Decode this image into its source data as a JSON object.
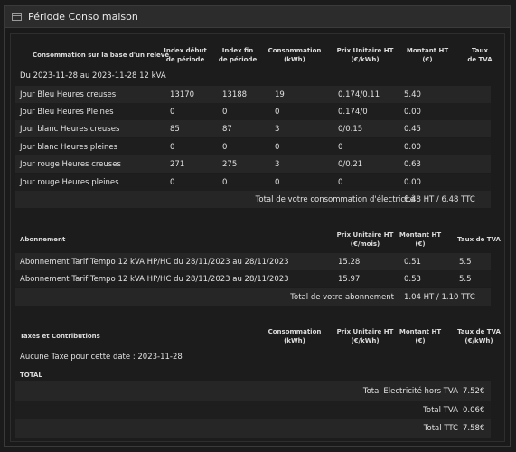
{
  "panel": {
    "title": "Période Conso maison"
  },
  "consumption": {
    "headers": {
      "label": "Consommation sur la base d'un relevé",
      "index_start": [
        "Index début",
        "de période"
      ],
      "index_end": [
        "Index fin",
        "de période"
      ],
      "conso": [
        "Consommation",
        "(kWh)"
      ],
      "unit_price": [
        "Prix Unitaire HT",
        "(€/kWh)"
      ],
      "amount": [
        "Montant HT",
        "(€)"
      ],
      "vat": [
        "Taux",
        "de TVA"
      ]
    },
    "period": "Du 2023-11-28 au 2023-11-28 12 kVA",
    "rows": [
      {
        "label": "Jour Bleu Heures creuses",
        "start": "13170",
        "end": "13188",
        "kwh": "19",
        "price": "0.174/0.11",
        "amount": "5.40",
        "vat": ""
      },
      {
        "label": "Jour Bleu Heures Pleines",
        "start": "0",
        "end": "0",
        "kwh": "0",
        "price": "0.174/0",
        "amount": "0.00",
        "vat": ""
      },
      {
        "label": "Jour blanc Heures creuses",
        "start": "85",
        "end": "87",
        "kwh": "3",
        "price": "0/0.15",
        "amount": "0.45",
        "vat": ""
      },
      {
        "label": "Jour blanc Heures pleines",
        "start": "0",
        "end": "0",
        "kwh": "0",
        "price": "0",
        "amount": "0.00",
        "vat": ""
      },
      {
        "label": "Jour rouge Heures creuses",
        "start": "271",
        "end": "275",
        "kwh": "3",
        "price": "0/0.21",
        "amount": "0.63",
        "vat": ""
      },
      {
        "label": "Jour rouge Heures pleines",
        "start": "0",
        "end": "0",
        "kwh": "0",
        "price": "0",
        "amount": "0.00",
        "vat": ""
      }
    ],
    "total_label": "Total de votre consommation d'électricité",
    "total_value": "6.48 HT / 6.48 TTC"
  },
  "subscription": {
    "headers": {
      "label": "Abonnement",
      "unit_price": [
        "Prix Unitaire HT",
        "(€/mois)"
      ],
      "amount": [
        "Montant HT",
        "(€)"
      ],
      "vat": [
        "Taux de TVA",
        ""
      ]
    },
    "rows": [
      {
        "label": "Abonnement Tarif Tempo 12 kVA HP/HC du 28/11/2023 au 28/11/2023",
        "price": "15.28",
        "amount": "0.51",
        "vat": "5.5"
      },
      {
        "label": "Abonnement Tarif Tempo 12 kVA HP/HC du 28/11/2023 au 28/11/2023",
        "price": "15.97",
        "amount": "0.53",
        "vat": "5.5"
      }
    ],
    "total_label": "Total de votre abonnement",
    "total_value": "1.04 HT / 1.10 TTC"
  },
  "taxes": {
    "headers": {
      "label": "Taxes et Contributions",
      "conso": [
        "Consommation",
        "(kWh)"
      ],
      "unit_price": [
        "Prix Unitaire HT",
        "(€/kWh)"
      ],
      "amount": [
        "Montant HT",
        "(€)"
      ],
      "vat": [
        "Taux de TVA",
        "(€/kWh)"
      ]
    },
    "none_text": "Aucune Taxe pour cette date : 2023-11-28",
    "total_heading": "TOTAL",
    "totals": [
      {
        "label": "Total Electricité hors TVA",
        "value": "7.52€"
      },
      {
        "label": "Total TVA",
        "value": "0.06€"
      },
      {
        "label": "Total TTC",
        "value": "7.58€"
      }
    ]
  }
}
